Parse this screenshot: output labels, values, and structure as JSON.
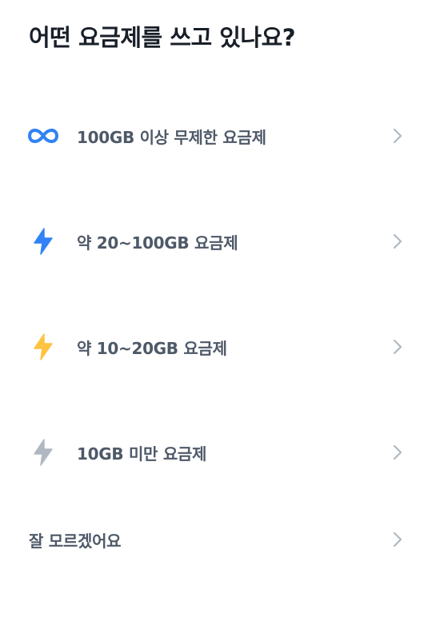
{
  "title": "어떤 요금제를 쓰고 있나요?",
  "options": [
    {
      "label": "100GB 이상 무제한 요금제",
      "icon": "infinity-icon",
      "icon_color": "#3182f6"
    },
    {
      "label": "약 20~100GB 요금제",
      "icon": "lightning-icon",
      "icon_color": "#3182f6"
    },
    {
      "label": "약 10~20GB 요금제",
      "icon": "lightning-icon",
      "icon_color": "#ffc342"
    },
    {
      "label": "10GB 미만 요금제",
      "icon": "lightning-icon",
      "icon_color": "#b0b8c1"
    },
    {
      "label": "잘 모르겠어요",
      "icon": null
    }
  ],
  "chevron_icon": "chevron-right-icon",
  "colors": {
    "title": "#191f28",
    "label": "#4e5968",
    "chevron": "#b0b8c1"
  }
}
